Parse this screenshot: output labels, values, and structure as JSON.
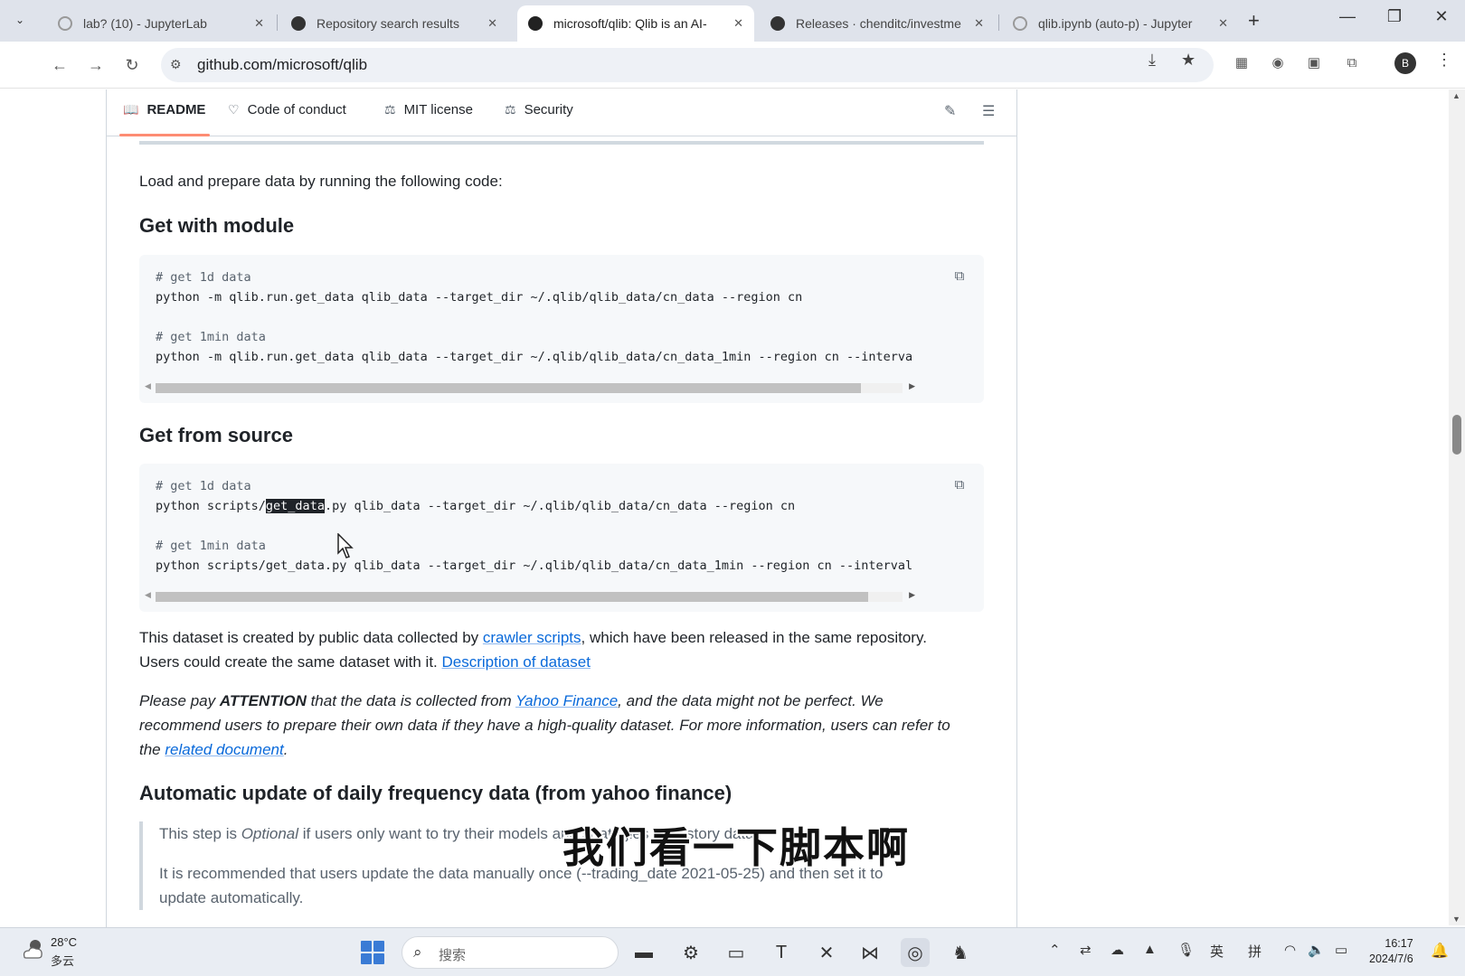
{
  "browser": {
    "tabs": [
      {
        "title": "lab? (10) - JupyterLab",
        "favicon": "jupyter-icon",
        "active": false
      },
      {
        "title": "Repository search results",
        "favicon": "github-icon",
        "active": false
      },
      {
        "title": "microsoft/qlib: Qlib is an AI-",
        "favicon": "github-icon",
        "active": true
      },
      {
        "title": "Releases · chenditc/investme",
        "favicon": "github-icon",
        "active": false
      },
      {
        "title": "qlib.ipynb (auto-p) - Jupyter",
        "favicon": "jupyter-icon",
        "active": false
      }
    ],
    "new_tab": "+",
    "window_controls": {
      "minimize": "—",
      "restore": "❐",
      "close": "✕"
    },
    "url": "github.com/microsoft/qlib",
    "profile_initial": "B"
  },
  "readme_nav": {
    "items": [
      {
        "label": "README",
        "icon": "book-icon",
        "active": true
      },
      {
        "label": "Code of conduct",
        "icon": "heart-icon",
        "active": false
      },
      {
        "label": "MIT license",
        "icon": "scale-icon",
        "active": false
      },
      {
        "label": "Security",
        "icon": "scale-icon",
        "active": false
      }
    ]
  },
  "content": {
    "intro": "Load and prepare data by running the following code:",
    "h_module": "Get with module",
    "code_module": {
      "lines": [
        {
          "text": "# get 1d data",
          "comment": true
        },
        {
          "text": "python -m qlib.run.get_data qlib_data --target_dir ~/.qlib/qlib_data/cn_data --region cn",
          "comment": false
        },
        {
          "text": "",
          "comment": false
        },
        {
          "text": "# get 1min data",
          "comment": true
        },
        {
          "text": "python -m qlib.run.get_data qlib_data --target_dir ~/.qlib/qlib_data/cn_data_1min --region cn --interva",
          "comment": false
        }
      ]
    },
    "h_source": "Get from source",
    "code_source": {
      "l1": "# get 1d data",
      "l2_pre": "python scripts/",
      "l2_sel": "get_data",
      "l2_post": ".py qlib_data --target_dir ~/.qlib/qlib_data/cn_data --region cn",
      "l4": "# get 1min data",
      "l5": "python scripts/get_data.py qlib_data --target_dir ~/.qlib/qlib_data/cn_data_1min --region cn --interval"
    },
    "p1": {
      "a": "This dataset is created by public data collected by ",
      "link1": "crawler scripts",
      "b": ", which have been released in the same repository.",
      "c": "Users could create the same dataset with it. ",
      "link2": "Description of dataset"
    },
    "p2": {
      "a": "Please pay ",
      "strong": "ATTENTION",
      "b": " that the data is collected from ",
      "link1": "Yahoo Finance",
      "c": ", and the data might not be perfect. We",
      "d": "recommend users to prepare their own data if they have a high-quality dataset. For more information, users can refer to",
      "e": "the ",
      "link2": "related document",
      "f": "."
    },
    "h_auto": "Automatic update of daily frequency data (from yahoo finance)",
    "quote1": {
      "a": "This step is ",
      "em": "Optional",
      "b": " if users only want to try their models and strategies on history data."
    },
    "quote2": "It is recommended that users update the data manually once (--trading_date 2021-05-25) and then set it to",
    "quote3": "update automatically."
  },
  "subtitle": "我们看一下脚本啊",
  "taskbar": {
    "weather_temp": "28°C",
    "weather_desc": "多云",
    "search_placeholder": "搜索",
    "ime_lang": "英",
    "ime_mode": "拼",
    "time": "16:17",
    "date": "2024/7/6"
  },
  "colors": {
    "link": "#0969da",
    "accent_underline": "#fd8c73",
    "code_bg": "#f6f8fa"
  }
}
